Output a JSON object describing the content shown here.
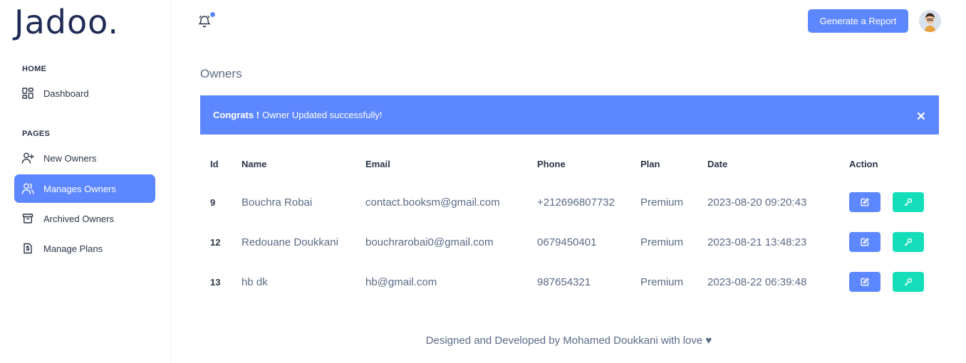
{
  "brand": {
    "logo": "Jadoo."
  },
  "sidebar": {
    "sections": [
      {
        "caption": "HOME",
        "items": [
          {
            "label": "Dashboard",
            "icon": "dashboard-icon"
          }
        ]
      },
      {
        "caption": "PAGES",
        "items": [
          {
            "label": "New Owners",
            "icon": "user-plus-icon"
          },
          {
            "label": "Manages Owners",
            "icon": "users-icon",
            "active": true
          },
          {
            "label": "Archived Owners",
            "icon": "archive-icon"
          },
          {
            "label": "Manage Plans",
            "icon": "invoice-icon"
          }
        ]
      }
    ]
  },
  "topbar": {
    "notification_icon": "bell-icon",
    "report_button": "Generate a Report",
    "avatar_icon": "user-avatar"
  },
  "page": {
    "title": "Owners"
  },
  "alert": {
    "strong": "Congrats !",
    "message": "Owner Updated successfully!",
    "close_icon": "close-icon"
  },
  "table": {
    "headers": [
      "Id",
      "Name",
      "Email",
      "Phone",
      "Plan",
      "Date",
      "Action"
    ],
    "rows": [
      {
        "id": "9",
        "name": "Bouchra Robai",
        "email": "contact.booksm@gmail.com",
        "phone": "+212696807732",
        "plan": "Premium",
        "date": "2023-08-20 09:20:43"
      },
      {
        "id": "12",
        "name": "Redouane Doukkani",
        "email": "bouchrarobai0@gmail.com",
        "phone": "0679450401",
        "plan": "Premium",
        "date": "2023-08-21 13:48:23"
      },
      {
        "id": "13",
        "name": "hb dk",
        "email": "hb@gmail.com",
        "phone": "987654321",
        "plan": "Premium",
        "date": "2023-08-22 06:39:48"
      }
    ]
  },
  "footer": {
    "text": "Designed and Developed by Mohamed Doukkani with love",
    "heart": "♥"
  },
  "colors": {
    "primary": "#5d87ff",
    "success": "#13deb9",
    "text": "#2a3547",
    "muted": "#5a6a85"
  }
}
